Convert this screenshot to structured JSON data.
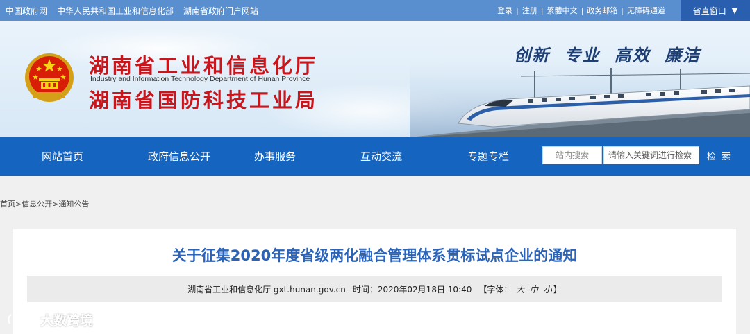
{
  "topbar": {
    "links": [
      "中国政府网",
      "中华人民共和国工业和信息化部",
      "湖南省政府门户网站"
    ],
    "right_links": [
      "登录",
      "注册",
      "繁體中文",
      "政务邮箱",
      "无障碍通道"
    ],
    "window_label": "省直窗口",
    "window_arrow": "▼"
  },
  "header": {
    "title_cn_1": "湖南省工业和信息化厅",
    "title_en": "Industry and Information Technology Department of Hunan Province",
    "title_cn_2": "湖南省国防科技工业局",
    "slogan": [
      "创新",
      "专业",
      "高效",
      "廉洁"
    ]
  },
  "nav": {
    "items": [
      "网站首页",
      "政府信息公开",
      "办事服务",
      "互动交流",
      "专题专栏"
    ],
    "search_label": "站内搜索",
    "search_placeholder": "请输入关键词进行检索",
    "search_button": "检 索"
  },
  "breadcrumb": {
    "items": [
      "首页",
      "信息公开",
      "通知公告"
    ],
    "separator": ">"
  },
  "article": {
    "title": "关于征集2020年度省级两化融合管理体系贯标试点企业的通知",
    "source": "湖南省工业和信息化厅 gxt.hunan.gov.cn",
    "time_label": "时间：",
    "time_value": "2020年02月18日 10:40",
    "font_open": "【字体：",
    "font_sizes": [
      "大",
      "中",
      "小"
    ],
    "font_close": "】"
  },
  "watermark": {
    "text": "大数跨境"
  },
  "colors": {
    "topbar": "#5a8fcf",
    "nav": "#1565c0",
    "title_red": "#c8161d",
    "article_title": "#2a63b8"
  }
}
